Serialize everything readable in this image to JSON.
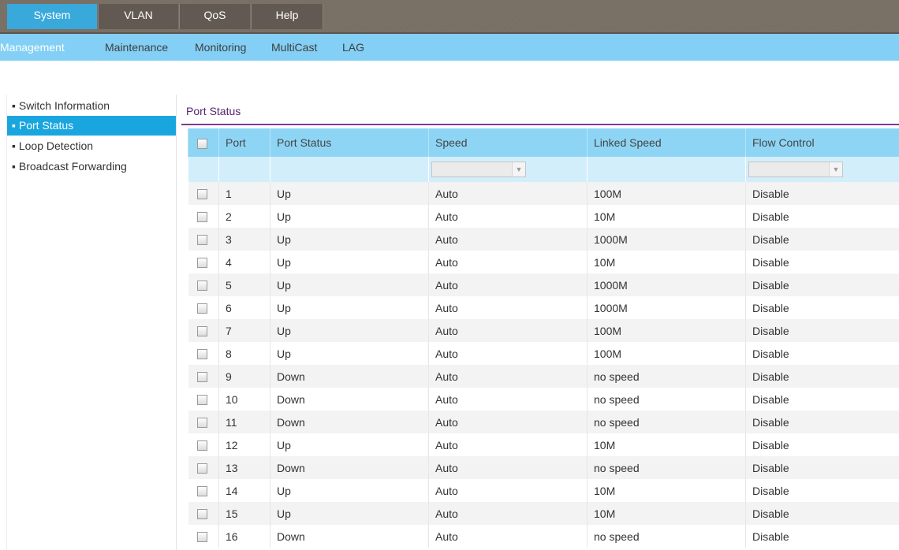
{
  "top_nav": [
    {
      "label": "System",
      "active": true
    },
    {
      "label": "VLAN",
      "active": false
    },
    {
      "label": "QoS",
      "active": false
    },
    {
      "label": "Help",
      "active": false
    }
  ],
  "sub_nav": [
    {
      "label": "Management",
      "active": true
    },
    {
      "label": "Maintenance",
      "active": false
    },
    {
      "label": "Monitoring",
      "active": false
    },
    {
      "label": "MultiCast",
      "active": false
    },
    {
      "label": "LAG",
      "active": false
    }
  ],
  "sidebar": [
    {
      "label": "Switch Information",
      "active": false
    },
    {
      "label": "Port Status",
      "active": true
    },
    {
      "label": "Loop Detection",
      "active": false
    },
    {
      "label": "Broadcast Forwarding",
      "active": false
    }
  ],
  "section_title": "Port Status",
  "table": {
    "headers": [
      "Port",
      "Port Status",
      "Speed",
      "Linked Speed",
      "Flow Control"
    ],
    "filter": {
      "speed": "",
      "flow_control": ""
    },
    "rows": [
      {
        "port": "1",
        "status": "Up",
        "speed": "Auto",
        "linked": "100M",
        "flow": "Disable"
      },
      {
        "port": "2",
        "status": "Up",
        "speed": "Auto",
        "linked": "10M",
        "flow": "Disable"
      },
      {
        "port": "3",
        "status": "Up",
        "speed": "Auto",
        "linked": "1000M",
        "flow": "Disable"
      },
      {
        "port": "4",
        "status": "Up",
        "speed": "Auto",
        "linked": "10M",
        "flow": "Disable"
      },
      {
        "port": "5",
        "status": "Up",
        "speed": "Auto",
        "linked": "1000M",
        "flow": "Disable"
      },
      {
        "port": "6",
        "status": "Up",
        "speed": "Auto",
        "linked": "1000M",
        "flow": "Disable"
      },
      {
        "port": "7",
        "status": "Up",
        "speed": "Auto",
        "linked": "100M",
        "flow": "Disable"
      },
      {
        "port": "8",
        "status": "Up",
        "speed": "Auto",
        "linked": "100M",
        "flow": "Disable"
      },
      {
        "port": "9",
        "status": "Down",
        "speed": "Auto",
        "linked": "no speed",
        "flow": "Disable"
      },
      {
        "port": "10",
        "status": "Down",
        "speed": "Auto",
        "linked": "no speed",
        "flow": "Disable"
      },
      {
        "port": "11",
        "status": "Down",
        "speed": "Auto",
        "linked": "no speed",
        "flow": "Disable"
      },
      {
        "port": "12",
        "status": "Up",
        "speed": "Auto",
        "linked": "10M",
        "flow": "Disable"
      },
      {
        "port": "13",
        "status": "Down",
        "speed": "Auto",
        "linked": "no speed",
        "flow": "Disable"
      },
      {
        "port": "14",
        "status": "Up",
        "speed": "Auto",
        "linked": "10M",
        "flow": "Disable"
      },
      {
        "port": "15",
        "status": "Up",
        "speed": "Auto",
        "linked": "10M",
        "flow": "Disable"
      },
      {
        "port": "16",
        "status": "Down",
        "speed": "Auto",
        "linked": "no speed",
        "flow": "Disable"
      }
    ]
  },
  "colors": {
    "top_nav_bg": "#776e64",
    "active_tab": "#39a9dc",
    "sub_nav_bg": "#83cff5",
    "sidebar_active": "#19a6de",
    "accent_line": "#7c3b8f"
  }
}
